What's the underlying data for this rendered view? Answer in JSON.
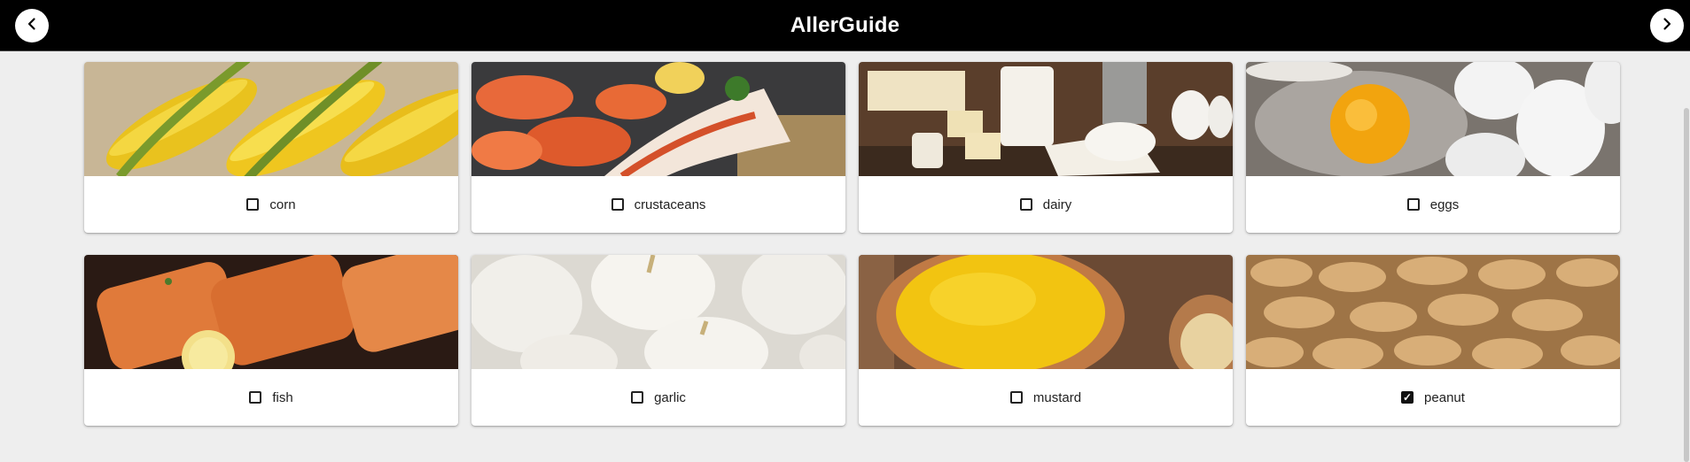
{
  "app": {
    "title": "AllerGuide",
    "prev_icon": "chevron-left-icon",
    "next_icon": "chevron-right-icon"
  },
  "allergens": [
    {
      "label": "corn",
      "checked": false,
      "image": "corn-photo"
    },
    {
      "label": "crustaceans",
      "checked": false,
      "image": "crustaceans-photo"
    },
    {
      "label": "dairy",
      "checked": false,
      "image": "dairy-photo"
    },
    {
      "label": "eggs",
      "checked": false,
      "image": "eggs-photo"
    },
    {
      "label": "fish",
      "checked": false,
      "image": "fish-photo"
    },
    {
      "label": "garlic",
      "checked": false,
      "image": "garlic-photo"
    },
    {
      "label": "mustard",
      "checked": false,
      "image": "mustard-photo"
    },
    {
      "label": "peanut",
      "checked": true,
      "image": "peanut-photo"
    }
  ]
}
